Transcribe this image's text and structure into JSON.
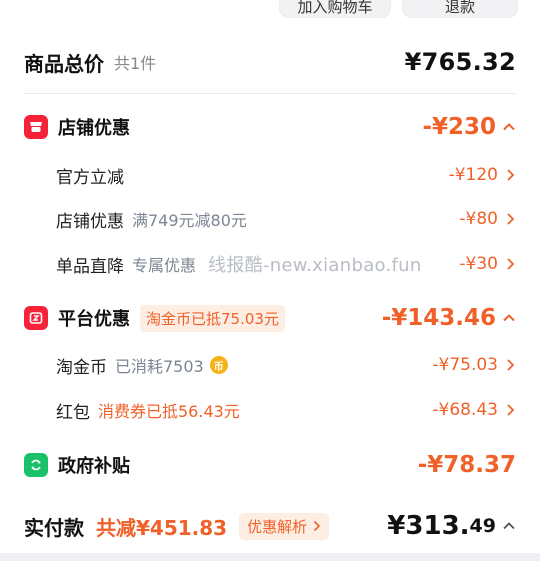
{
  "top_buttons": {
    "add_to_cart": "加入购物车",
    "pay": "退款"
  },
  "summary": {
    "title": "商品总价",
    "count": "共1件",
    "price": "¥765.32"
  },
  "shop_discount": {
    "title": "店铺优惠",
    "amount": "-¥230",
    "items": [
      {
        "label": "官方立减",
        "note": "",
        "amount": "-¥120"
      },
      {
        "label": "店铺优惠",
        "note": "满749元减80元",
        "amount": "-¥80"
      },
      {
        "label": "单品直降",
        "note": "专属优惠",
        "amount": "-¥30"
      }
    ]
  },
  "watermark": "线报酷-new.xianbao.fun",
  "platform_discount": {
    "title": "平台优惠",
    "tag": "淘金币已抵75.03元",
    "amount": "-¥143.46",
    "items": [
      {
        "label": "淘金币",
        "note": "已消耗7503",
        "amount": "-¥75.03",
        "coin_icon": "taojinbi-coin-icon"
      },
      {
        "label": "红包",
        "note": "消费券已抵56.43元",
        "amount": "-¥68.43"
      }
    ]
  },
  "government_subsidy": {
    "title": "政府补贴",
    "amount": "-¥78.37"
  },
  "bottom": {
    "title": "实付款",
    "reduce": "共减¥451.83",
    "analysis": "优惠解析",
    "paid_main": "¥313.",
    "paid_decimal": "49"
  },
  "colors": {
    "accent": "#f0612a",
    "shop_icon": "#f5223a",
    "subsidy_icon": "#19c26a",
    "tag_bg": "#fdeee4"
  }
}
